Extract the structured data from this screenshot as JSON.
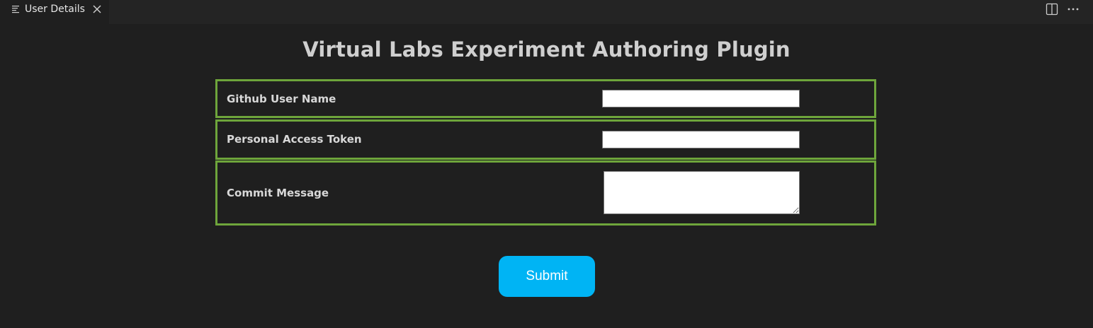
{
  "tab": {
    "title": "User Details",
    "icon": "preview-lines-icon",
    "close_icon": "close-icon"
  },
  "editor_actions": {
    "split_icon": "split-editor-icon",
    "more_icon": "more-actions-icon"
  },
  "page": {
    "title": "Virtual Labs Experiment Authoring Plugin"
  },
  "form": {
    "fields": [
      {
        "label": "Github User Name",
        "value": "",
        "type": "text"
      },
      {
        "label": "Personal Access Token",
        "value": "",
        "type": "text"
      },
      {
        "label": "Commit Message",
        "value": "",
        "type": "textarea"
      }
    ],
    "submit_label": "Submit"
  },
  "colors": {
    "background": "#1f1f1f",
    "tabbar": "#242424",
    "border_green": "#6ea53b",
    "submit_blue": "#00b4f4",
    "title_text": "#cfcfcf"
  }
}
